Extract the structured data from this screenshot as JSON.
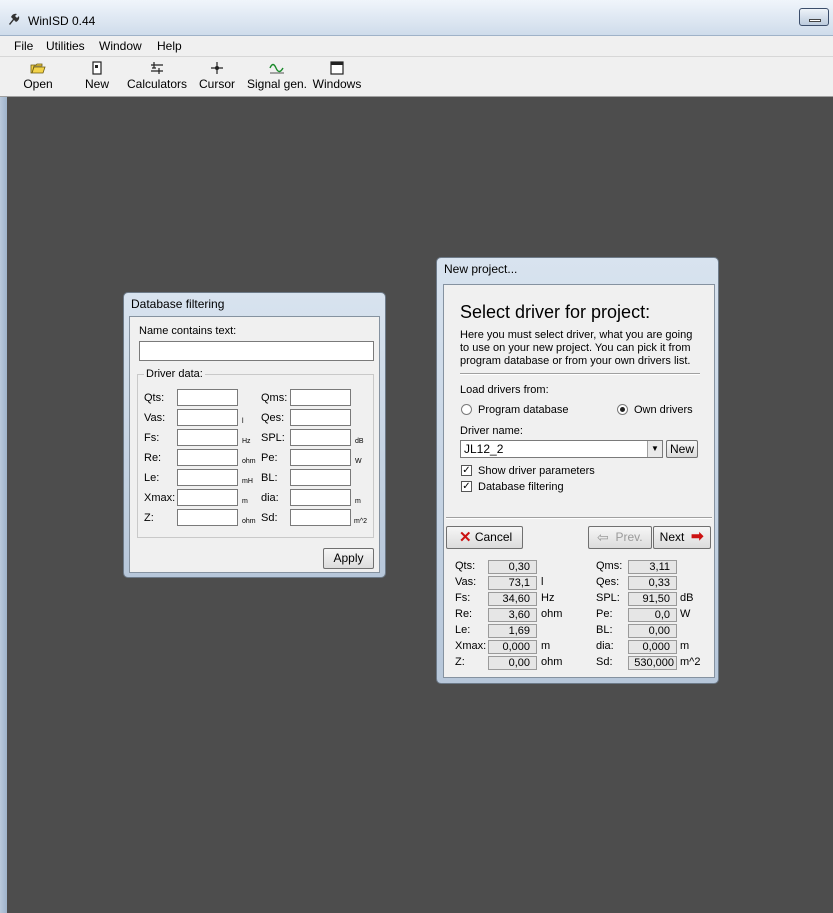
{
  "app": {
    "title": "WinISD 0.44"
  },
  "menu": [
    "File",
    "Utilities",
    "Window",
    "Help"
  ],
  "toolbar": [
    "Open",
    "New",
    "Calculators",
    "Cursor",
    "Signal gen.",
    "Windows"
  ],
  "filter_window": {
    "title": "Database filtering",
    "name_label": "Name contains text:",
    "name_value": "",
    "group_label": "Driver data:",
    "left_params": [
      {
        "label": "Qts:",
        "unit": ""
      },
      {
        "label": "Vas:",
        "unit": "l"
      },
      {
        "label": "Fs:",
        "unit": "Hz"
      },
      {
        "label": "Re:",
        "unit": "ohm"
      },
      {
        "label": "Le:",
        "unit": "mH"
      },
      {
        "label": "Xmax:",
        "unit": "m"
      },
      {
        "label": "Z:",
        "unit": "ohm"
      }
    ],
    "right_params": [
      {
        "label": "Qms:",
        "unit": ""
      },
      {
        "label": "Qes:",
        "unit": ""
      },
      {
        "label": "SPL:",
        "unit": "dB"
      },
      {
        "label": "Pe:",
        "unit": "W"
      },
      {
        "label": "BL:",
        "unit": ""
      },
      {
        "label": "dia:",
        "unit": "m"
      },
      {
        "label": "Sd:",
        "unit": "m^2"
      }
    ],
    "apply_label": "Apply"
  },
  "project_window": {
    "title": "New project...",
    "heading": "Select driver for project:",
    "description": "Here you must select driver, what you are going to use on your new project. You can pick it from program database or from your own drivers list.",
    "description_lines": [
      "Here you must select driver, what you are going",
      "to use on your new project. You can pick it from",
      "program database or from your own drivers list."
    ],
    "load_from_label": "Load drivers from:",
    "radio_program": "Program database",
    "radio_own": "Own drivers",
    "radio_selected": "Own drivers",
    "driver_name_label": "Driver name:",
    "driver_name_value": "JL12_2",
    "new_button": "New",
    "show_params_label": "Show driver parameters",
    "db_filter_label": "Database filtering",
    "cancel_label": "Cancel",
    "prev_label": "Prev.",
    "next_label": "Next",
    "left_params": [
      {
        "label": "Qts:",
        "value": "0,30",
        "unit": ""
      },
      {
        "label": "Vas:",
        "value": "73,1",
        "unit": "l"
      },
      {
        "label": "Fs:",
        "value": "34,60",
        "unit": "Hz"
      },
      {
        "label": "Re:",
        "value": "3,60",
        "unit": "ohm"
      },
      {
        "label": "Le:",
        "value": "1,69",
        "unit": ""
      },
      {
        "label": "Xmax:",
        "value": "0,000",
        "unit": "m"
      },
      {
        "label": "Z:",
        "value": "0,00",
        "unit": "ohm"
      }
    ],
    "right_params": [
      {
        "label": "Qms:",
        "value": "3,11",
        "unit": ""
      },
      {
        "label": "Qes:",
        "value": "0,33",
        "unit": ""
      },
      {
        "label": "SPL:",
        "value": "91,50",
        "unit": "dB"
      },
      {
        "label": "Pe:",
        "value": "0,0",
        "unit": "W"
      },
      {
        "label": "BL:",
        "value": "0,00",
        "unit": ""
      },
      {
        "label": "dia:",
        "value": "0,000",
        "unit": "m"
      },
      {
        "label": "Sd:",
        "value": "530,000",
        "unit": "m^2"
      }
    ]
  }
}
